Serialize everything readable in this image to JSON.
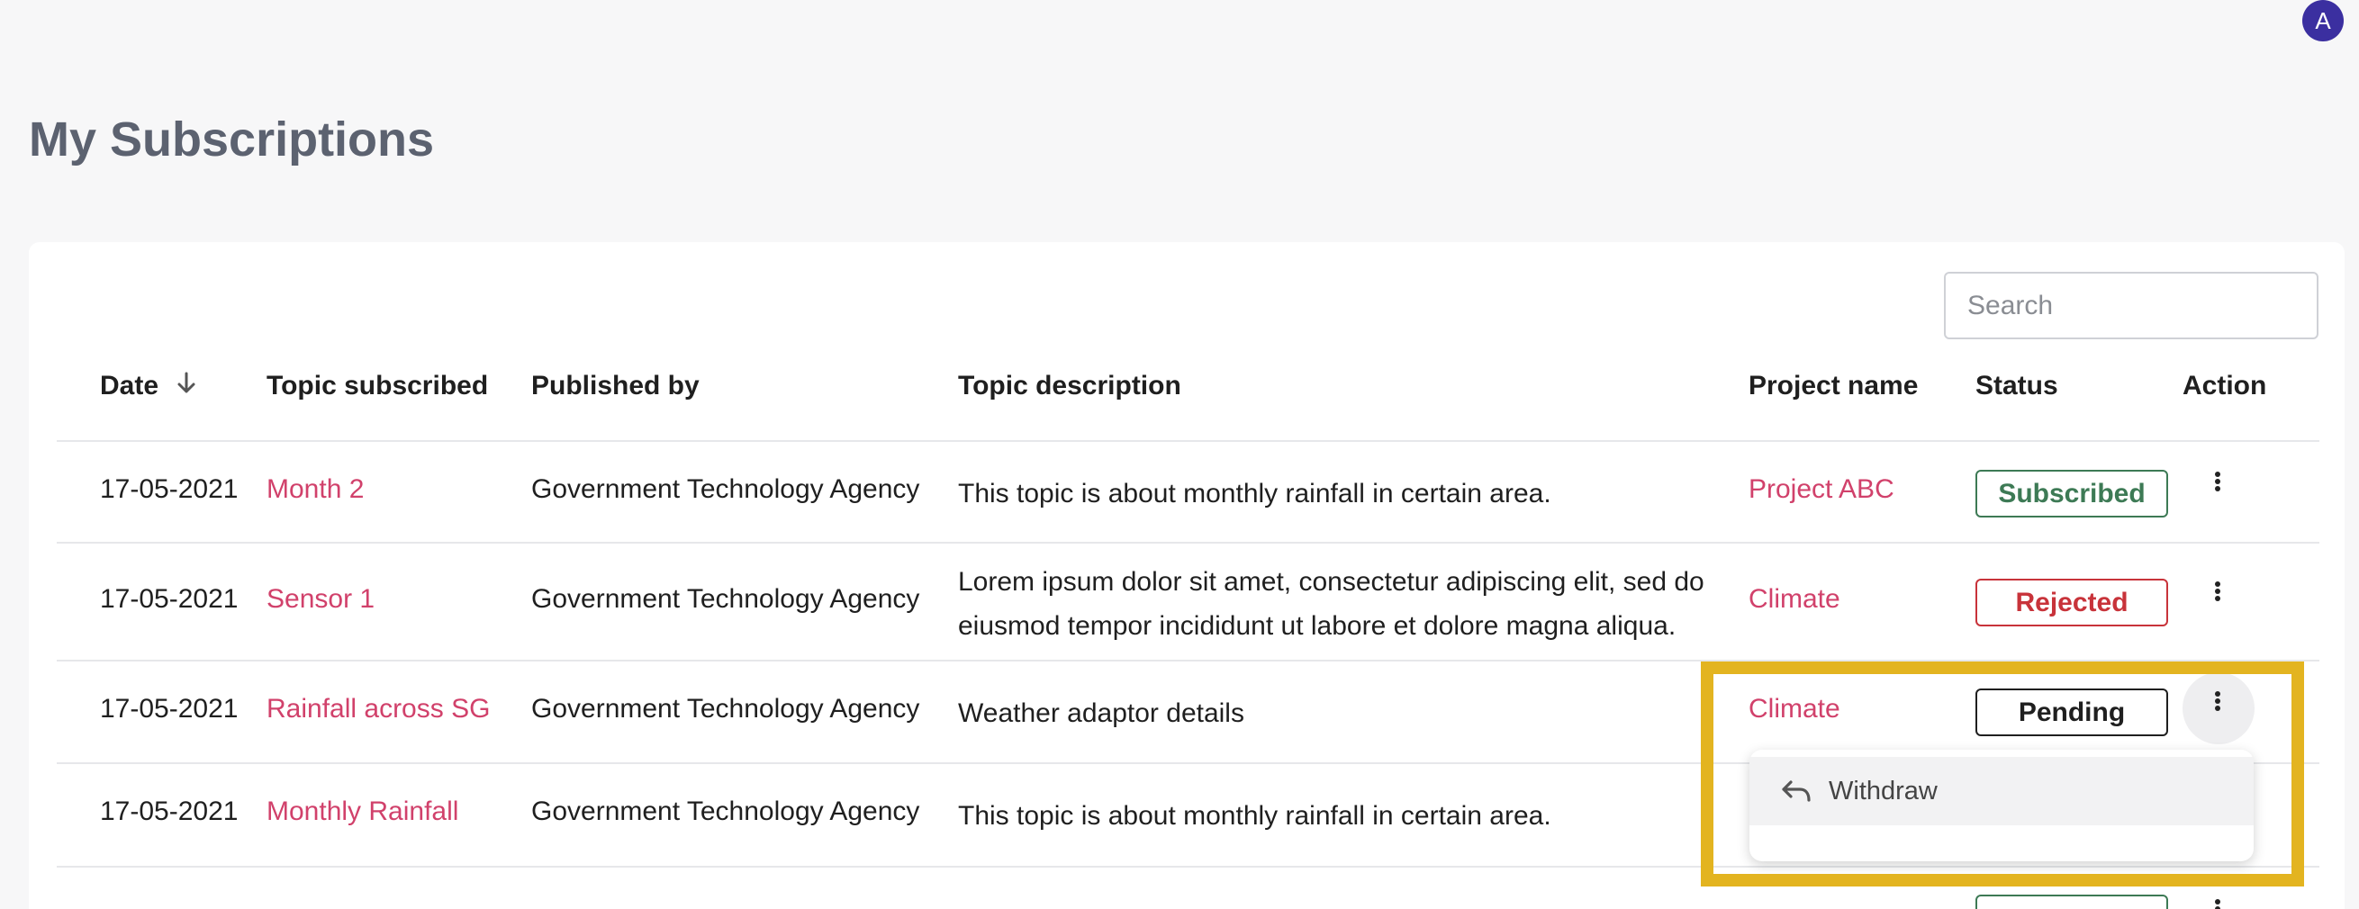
{
  "header": {
    "avatar_initial": "A"
  },
  "page": {
    "title": "My Subscriptions"
  },
  "search": {
    "placeholder": "Search",
    "value": ""
  },
  "table": {
    "columns": {
      "date": "Date",
      "topic": "Topic subscribed",
      "publisher": "Published by",
      "description": "Topic description",
      "project": "Project name",
      "status": "Status",
      "action": "Action"
    },
    "rows": [
      {
        "date": "17-05-2021",
        "topic": "Month 2",
        "publisher": "Government Technology Agency",
        "description": "This topic is about monthly rainfall in certain area.",
        "project": "Project ABC",
        "status": "Subscribed"
      },
      {
        "date": "17-05-2021",
        "topic": "Sensor 1",
        "publisher": "Government Technology Agency",
        "description": "Lorem ipsum dolor sit amet, consectetur adipiscing elit, sed do eiusmod tempor incididunt ut labore et dolore magna aliqua.",
        "project": "Climate",
        "status": "Rejected"
      },
      {
        "date": "17-05-2021",
        "topic": "Rainfall across SG",
        "publisher": "Government Technology Agency",
        "description": "Weather adaptor details",
        "project": "Climate",
        "status": "Pending"
      },
      {
        "date": "17-05-2021",
        "topic": "Monthly Rainfall",
        "publisher": "Government Technology Agency",
        "description": "This topic is about monthly rainfall in certain area.",
        "project": "",
        "status": ""
      }
    ]
  },
  "action_menu": {
    "items": [
      {
        "label": "Withdraw",
        "icon": "undo-icon"
      }
    ]
  },
  "colors": {
    "link": "#d1416b",
    "subscribed": "#3d7a55",
    "rejected": "#c8333a",
    "pending": "#1f1f1f",
    "highlight": "#e3b420",
    "avatar": "#3b2fa0"
  }
}
